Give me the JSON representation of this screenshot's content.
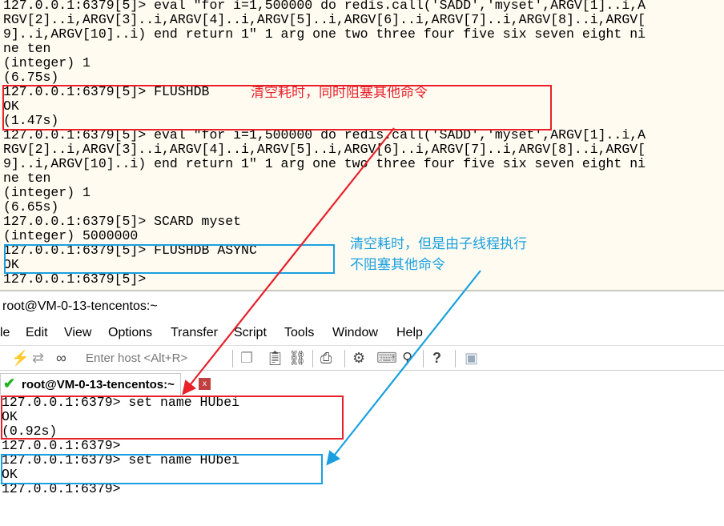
{
  "top_terminal": {
    "lines": [
      "127.0.0.1:6379[5]> eval \"for i=1,500000 do redis.call('SADD','myset',ARGV[1]..i,A",
      "RGV[2]..i,ARGV[3]..i,ARGV[4]..i,ARGV[5]..i,ARGV[6]..i,ARGV[7]..i,ARGV[8]..i,ARGV[",
      "9]..i,ARGV[10]..i) end return 1\" 1 arg one two three four five six seven eight ni",
      "ne ten",
      "(integer) 1",
      "(6.75s)",
      "127.0.0.1:6379[5]> FLUSHDB",
      "OK",
      "(1.47s)",
      "127.0.0.1:6379[5]> eval \"for i=1,500000 do redis.call('SADD','myset',ARGV[1]..i,A",
      "RGV[2]..i,ARGV[3]..i,ARGV[4]..i,ARGV[5]..i,ARGV[6]..i,ARGV[7]..i,ARGV[8]..i,ARGV[",
      "9]..i,ARGV[10]..i) end return 1\" 1 arg one two three four five six seven eight ni",
      "ne ten",
      "(integer) 1",
      "(6.65s)",
      "127.0.0.1:6379[5]> SCARD myset",
      "(integer) 5000000",
      "127.0.0.1:6379[5]> FLUSHDB ASYNC",
      "OK",
      "127.0.0.1:6379[5]>"
    ]
  },
  "window": {
    "title": "root@VM-0-13-tencentos:~"
  },
  "menu": [
    "le",
    "Edit",
    "View",
    "Options",
    "Transfer",
    "Script",
    "Tools",
    "Window",
    "Help"
  ],
  "toolbar": {
    "host_placeholder": "Enter host <Alt+R>"
  },
  "tab": {
    "label": "root@VM-0-13-tencentos:~",
    "close": "x"
  },
  "bottom_terminal": {
    "lines": [
      "127.0.0.1:6379> set name HUbei",
      "OK",
      "(0.92s)",
      "127.0.0.1:6379>",
      "127.0.0.1:6379> set name HUbei",
      "OK",
      "127.0.0.1:6379>"
    ]
  },
  "annotations": {
    "sync": "清空耗时，同时阻塞其他命令",
    "async_1": "清空耗时，但是由子线程执行",
    "async_2": "不阻塞其他命令"
  },
  "colors": {
    "red": "#e8202a",
    "blue": "#1aa0e0"
  }
}
